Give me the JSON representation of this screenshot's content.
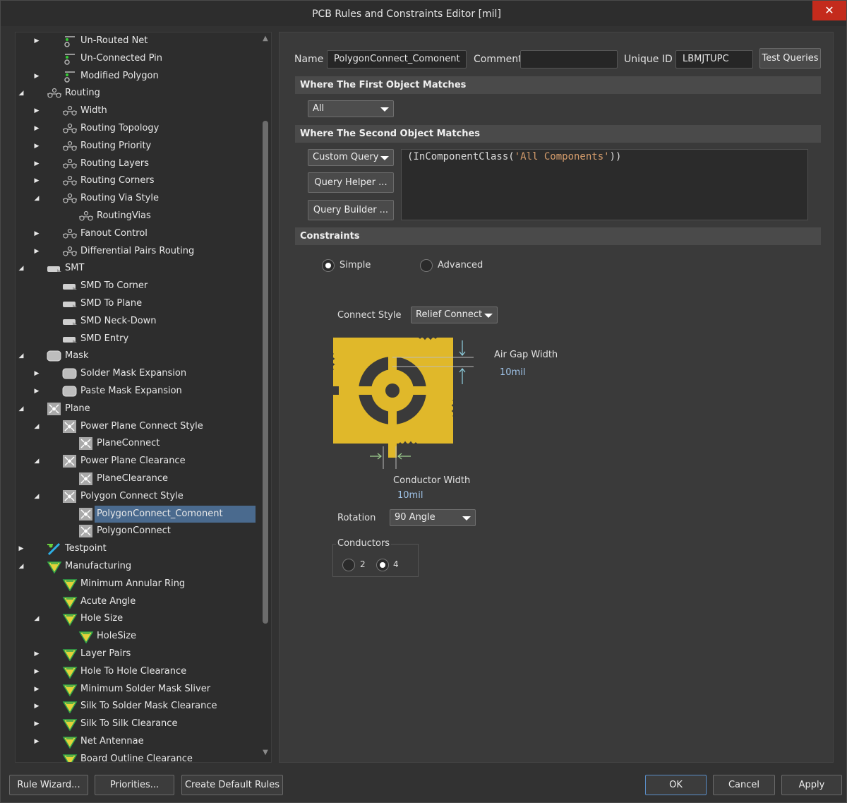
{
  "window": {
    "title": "PCB Rules and Constraints Editor [mil]",
    "close_glyph": "✕"
  },
  "tree": [
    {
      "label": "Un-Routed Net",
      "level": 2,
      "arrow": "right",
      "icon": "unrouted-net-icon"
    },
    {
      "label": "Un-Connected Pin",
      "level": 2,
      "arrow": "none",
      "icon": "unconnected-pin-icon"
    },
    {
      "label": "Modified Polygon",
      "level": 2,
      "arrow": "right",
      "icon": "modified-polygon-icon"
    },
    {
      "label": "Routing",
      "level": 1,
      "arrow": "down",
      "icon": "routing-icon"
    },
    {
      "label": "Width",
      "level": 2,
      "arrow": "right",
      "icon": "routing-icon"
    },
    {
      "label": "Routing Topology",
      "level": 2,
      "arrow": "right",
      "icon": "routing-icon"
    },
    {
      "label": "Routing Priority",
      "level": 2,
      "arrow": "right",
      "icon": "routing-icon"
    },
    {
      "label": "Routing Layers",
      "level": 2,
      "arrow": "right",
      "icon": "routing-icon"
    },
    {
      "label": "Routing Corners",
      "level": 2,
      "arrow": "right",
      "icon": "routing-icon"
    },
    {
      "label": "Routing Via Style",
      "level": 2,
      "arrow": "down",
      "icon": "routing-icon"
    },
    {
      "label": "RoutingVias",
      "level": 3,
      "arrow": "none",
      "icon": "routing-icon"
    },
    {
      "label": "Fanout Control",
      "level": 2,
      "arrow": "right",
      "icon": "routing-icon"
    },
    {
      "label": "Differential Pairs Routing",
      "level": 2,
      "arrow": "right",
      "icon": "routing-icon"
    },
    {
      "label": "SMT",
      "level": 1,
      "arrow": "down",
      "icon": "smt-icon"
    },
    {
      "label": "SMD To Corner",
      "level": 2,
      "arrow": "none",
      "icon": "smt-icon"
    },
    {
      "label": "SMD To Plane",
      "level": 2,
      "arrow": "none",
      "icon": "smt-icon"
    },
    {
      "label": "SMD Neck-Down",
      "level": 2,
      "arrow": "none",
      "icon": "smt-icon"
    },
    {
      "label": "SMD Entry",
      "level": 2,
      "arrow": "none",
      "icon": "smt-icon"
    },
    {
      "label": "Mask",
      "level": 1,
      "arrow": "down",
      "icon": "mask-icon"
    },
    {
      "label": "Solder Mask Expansion",
      "level": 2,
      "arrow": "right",
      "icon": "mask-icon"
    },
    {
      "label": "Paste Mask Expansion",
      "level": 2,
      "arrow": "right",
      "icon": "mask-icon"
    },
    {
      "label": "Plane",
      "level": 1,
      "arrow": "down",
      "icon": "plane-icon"
    },
    {
      "label": "Power Plane Connect Style",
      "level": 2,
      "arrow": "down",
      "icon": "plane-icon"
    },
    {
      "label": "PlaneConnect",
      "level": 3,
      "arrow": "none",
      "icon": "plane-icon"
    },
    {
      "label": "Power Plane Clearance",
      "level": 2,
      "arrow": "down",
      "icon": "plane-icon"
    },
    {
      "label": "PlaneClearance",
      "level": 3,
      "arrow": "none",
      "icon": "plane-icon"
    },
    {
      "label": "Polygon Connect Style",
      "level": 2,
      "arrow": "down",
      "icon": "plane-icon"
    },
    {
      "label": "PolygonConnect_Comonent",
      "level": 3,
      "arrow": "none",
      "icon": "plane-icon",
      "selected": true
    },
    {
      "label": "PolygonConnect",
      "level": 3,
      "arrow": "none",
      "icon": "plane-icon"
    },
    {
      "label": "Testpoint",
      "level": 1,
      "arrow": "right",
      "icon": "testpoint-icon"
    },
    {
      "label": "Manufacturing",
      "level": 1,
      "arrow": "down",
      "icon": "manufacturing-icon"
    },
    {
      "label": "Minimum Annular Ring",
      "level": 2,
      "arrow": "none",
      "icon": "manufacturing-icon"
    },
    {
      "label": "Acute Angle",
      "level": 2,
      "arrow": "none",
      "icon": "manufacturing-icon"
    },
    {
      "label": "Hole Size",
      "level": 2,
      "arrow": "down",
      "icon": "manufacturing-icon"
    },
    {
      "label": "HoleSize",
      "level": 3,
      "arrow": "none",
      "icon": "manufacturing-icon"
    },
    {
      "label": "Layer Pairs",
      "level": 2,
      "arrow": "right",
      "icon": "manufacturing-icon"
    },
    {
      "label": "Hole To Hole Clearance",
      "level": 2,
      "arrow": "right",
      "icon": "manufacturing-icon"
    },
    {
      "label": "Minimum Solder Mask Sliver",
      "level": 2,
      "arrow": "right",
      "icon": "manufacturing-icon"
    },
    {
      "label": "Silk To Solder Mask Clearance",
      "level": 2,
      "arrow": "right",
      "icon": "manufacturing-icon"
    },
    {
      "label": "Silk To Silk Clearance",
      "level": 2,
      "arrow": "right",
      "icon": "manufacturing-icon"
    },
    {
      "label": "Net Antennae",
      "level": 2,
      "arrow": "right",
      "icon": "manufacturing-icon"
    },
    {
      "label": "Board Outline Clearance",
      "level": 2,
      "arrow": "none",
      "icon": "manufacturing-icon"
    }
  ],
  "rule": {
    "name_label": "Name",
    "name_value": "PolygonConnect_Comonent",
    "comment_label": "Comment",
    "comment_value": "",
    "uid_label": "Unique ID",
    "uid_value": "LBMJTUPC",
    "test_queries": "Test Queries"
  },
  "first_match": {
    "header": "Where The First Object Matches",
    "combo": "All"
  },
  "second_match": {
    "header": "Where The Second Object Matches",
    "combo": "Custom Query",
    "query_helper": "Query Helper ...",
    "query_builder": "Query Builder ...",
    "query_prefix": "(InComponentClass(",
    "query_string": "'All Components'",
    "query_suffix": "))"
  },
  "constraints": {
    "header": "Constraints",
    "simple": "Simple",
    "advanced": "Advanced",
    "mode": "Simple",
    "connect_style_label": "Connect Style",
    "connect_style": "Relief Connect",
    "air_gap_label": "Air Gap Width",
    "air_gap_value": "10mil",
    "conductor_width_label": "Conductor Width",
    "conductor_width_value": "10mil",
    "rotation_label": "Rotation",
    "rotation": "90 Angle",
    "conductors_label": "Conductors",
    "conductors_option_2": "2",
    "conductors_option_4": "4",
    "conductors": 4
  },
  "colors": {
    "copper": "#e0b82a",
    "selection": "#4a6a8e",
    "close": "#c42b1c",
    "query_string": "#d69d6c",
    "value_text": "#9fc3e8"
  },
  "footer": {
    "rule_wizard": "Rule Wizard...",
    "priorities": "Priorities...",
    "create_defaults": "Create Default Rules",
    "ok": "OK",
    "cancel": "Cancel",
    "apply": "Apply"
  }
}
